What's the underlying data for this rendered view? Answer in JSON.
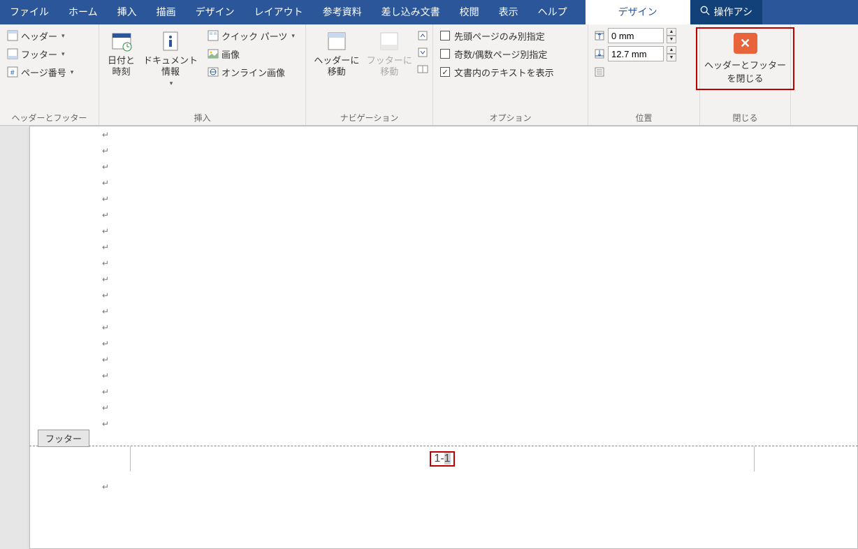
{
  "tabs": {
    "file": "ファイル",
    "home": "ホーム",
    "insert": "挿入",
    "draw": "描画",
    "design": "デザイン",
    "layout": "レイアウト",
    "references": "参考資料",
    "mailings": "差し込み文書",
    "review": "校閲",
    "view": "表示",
    "help": "ヘルプ",
    "context_design": "デザイン",
    "search_placeholder": "操作アシ"
  },
  "ribbon": {
    "group1": {
      "label": "ヘッダーとフッター",
      "header": "ヘッダー",
      "footer": "フッター",
      "page_number": "ページ番号"
    },
    "group2": {
      "label": "挿入",
      "date_time": "日付と\n時刻",
      "doc_info": "ドキュメント\n情報",
      "quick_parts": "クイック パーツ",
      "pictures": "画像",
      "online_pictures": "オンライン画像"
    },
    "group3": {
      "label": "ナビゲーション",
      "goto_header": "ヘッダーに\n移動",
      "goto_footer": "フッターに\n移動"
    },
    "group4": {
      "label": "オプション",
      "first_page": "先頭ページのみ別指定",
      "odd_even": "奇数/偶数ページ別指定",
      "show_text": "文書内のテキストを表示"
    },
    "group5": {
      "label": "位置",
      "top_value": "0 mm",
      "bottom_value": "12.7 mm"
    },
    "group6": {
      "label": "閉じる",
      "close_label": "ヘッダーとフッター\nを閉じる"
    }
  },
  "document": {
    "footer_tag": "フッター",
    "page_number_text_a": "1-",
    "page_number_text_b": "1",
    "para_mark": "↵"
  }
}
